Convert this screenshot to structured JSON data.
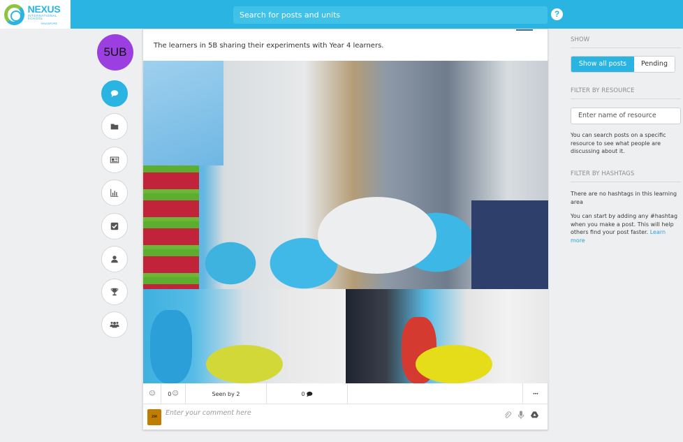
{
  "topbar": {
    "logo": {
      "name": "NEXUS",
      "subtitle": "INTERNATIONAL SCHOOL",
      "location": "SINGAPORE"
    },
    "search_placeholder": "Search for posts and units",
    "help_label": "?"
  },
  "left_nav": {
    "class_label": "5UB",
    "items": [
      {
        "name": "posts",
        "icon": "speech-bubble-icon",
        "active": true
      },
      {
        "name": "folders",
        "icon": "folder-icon",
        "active": false
      },
      {
        "name": "newspaper",
        "icon": "newspaper-icon",
        "active": false
      },
      {
        "name": "reports",
        "icon": "bar-chart-icon",
        "active": false
      },
      {
        "name": "tasks",
        "icon": "checkbox-icon",
        "active": false
      },
      {
        "name": "profile",
        "icon": "user-icon",
        "active": false
      },
      {
        "name": "achievements",
        "icon": "trophy-icon",
        "active": false
      },
      {
        "name": "groups",
        "icon": "users-group-icon",
        "active": false
      }
    ]
  },
  "post": {
    "caption": "The learners in 5B sharing their experiments with Year 4 learners.",
    "photos": [
      {
        "label": "Main classroom photo: learners around a table"
      },
      {
        "label": "Learners with experiment at yellow table"
      },
      {
        "label": "Learners gathered at yellow table"
      }
    ],
    "actions": {
      "react_icon": "☺",
      "reactions_count": "0",
      "reactions_icon": "☺",
      "seen_by": "Seen by 2",
      "comments_count": "0",
      "comments_icon": "💬",
      "more": "•••"
    },
    "comment": {
      "avatar_initials": "ZM",
      "placeholder": "Enter your comment here",
      "attach_icon": "paperclip-icon",
      "mic_icon": "microphone-icon",
      "drive_icon": "google-drive-icon"
    }
  },
  "right_panel": {
    "show_heading": "SHOW",
    "show_options": [
      "Show all posts",
      "Pending"
    ],
    "show_selected": "Show all posts",
    "resource_heading": "FILTER BY RESOURCE",
    "resource_placeholder": "Enter name of resource",
    "resource_help": "You can search posts on a specific resource to see what people are discussing about it.",
    "hashtag_heading": "FILTER BY HASHTAGS",
    "hashtag_empty": "There are no hashtags in this learning area",
    "hashtag_help": "You can start by adding any #hashtag when you make a post. This will help others find your post faster.",
    "learn_more": "Learn more"
  },
  "colors": {
    "brand_blue": "#29b4e2",
    "class_avatar": "#9b3fe0",
    "user_avatar": "#c17d00"
  }
}
